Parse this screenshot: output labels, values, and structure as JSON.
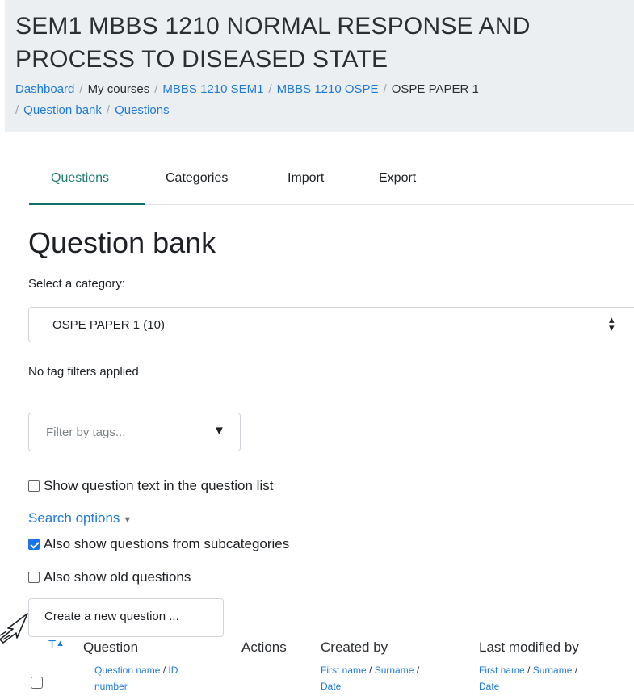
{
  "header": {
    "course_title": "SEM1 MBBS 1210 NORMAL RESPONSE AND PROCESS TO DISEASED STATE",
    "breadcrumb": {
      "dashboard": "Dashboard",
      "my_courses": "My courses",
      "course": "MBBS 1210 SEM1",
      "section": "MBBS 1210 OSPE",
      "quiz": "OSPE PAPER 1",
      "question_bank": "Question bank",
      "questions": "Questions"
    }
  },
  "tabs": [
    {
      "label": "Questions",
      "active": true
    },
    {
      "label": "Categories",
      "active": false
    },
    {
      "label": "Import",
      "active": false
    },
    {
      "label": "Export",
      "active": false
    }
  ],
  "main": {
    "heading": "Question bank",
    "select_label": "Select a category:",
    "selected_category": "OSPE PAPER 1 (10)",
    "no_tag_filters": "No tag filters applied",
    "tag_filter_placeholder": "Filter by tags...",
    "show_question_text": {
      "label": "Show question text in the question list",
      "checked": false
    },
    "search_options": "Search options",
    "subcategories": {
      "label": "Also show questions from subcategories",
      "checked": true
    },
    "old_questions": {
      "label": "Also show old questions",
      "checked": false
    },
    "create_button": "Create a new question ..."
  },
  "table": {
    "type_col": "T",
    "question_col": "Question",
    "question_sub": {
      "name": "Question name",
      "id": "ID",
      "number": "number"
    },
    "actions_col": "Actions",
    "created_col": "Created by",
    "created_sub": {
      "first": "First name",
      "last": "Surname",
      "date": "Date"
    },
    "modified_col": "Last modified by",
    "modified_sub": {
      "first": "First name",
      "last": "Surname",
      "date": "Date"
    }
  },
  "colors": {
    "link": "#1f7ad6",
    "active_tab": "#0f6e69",
    "header_bg": "#eceff1",
    "checkbox_checked": "#1a73e8"
  }
}
